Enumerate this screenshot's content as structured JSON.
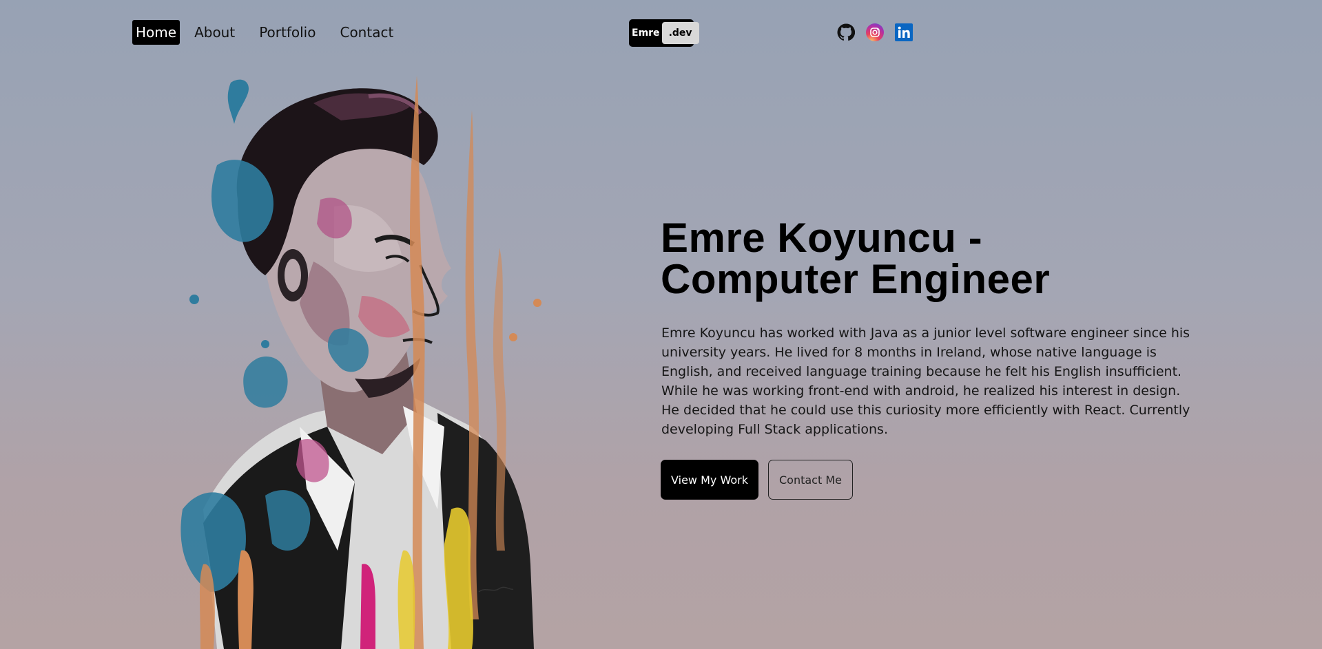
{
  "nav": {
    "items": [
      {
        "label": "Home",
        "active": true
      },
      {
        "label": "About",
        "active": false
      },
      {
        "label": "Portfolio",
        "active": false
      },
      {
        "label": "Contact",
        "active": false
      }
    ]
  },
  "logo": {
    "part1": "Emre",
    "part2": ".dev"
  },
  "socials": [
    {
      "icon": "github-icon",
      "color": "#111111"
    },
    {
      "icon": "instagram-icon",
      "color": "#c13584"
    },
    {
      "icon": "linkedin-icon",
      "color": "#0a66c2"
    }
  ],
  "hero": {
    "title_line1": "Emre Koyuncu -",
    "title_line2": "Computer Engineer",
    "description": "Emre Koyuncu has worked with Java as a junior level software engineer since his university years. He lived for 8 months in Ireland, whose native language is English, and received language training because he felt his English insufficient. While he was working front-end with android, he realized his interest in design. He decided that he could use this curiosity more efficiently with React. Currently developing Full Stack applications.",
    "primary_button": "View My Work",
    "secondary_button": "Contact Me"
  },
  "colors": {
    "accent": "#000000",
    "background_top": "#97a2b4",
    "background_bottom": "#b4a3a4"
  }
}
